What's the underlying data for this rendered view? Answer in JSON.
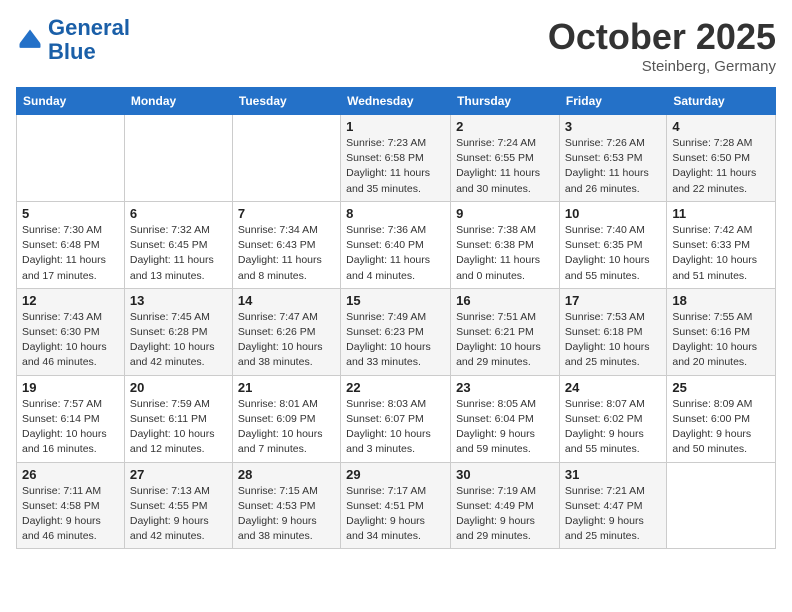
{
  "header": {
    "logo_line1": "General",
    "logo_line2": "Blue",
    "month": "October 2025",
    "location": "Steinberg, Germany"
  },
  "weekdays": [
    "Sunday",
    "Monday",
    "Tuesday",
    "Wednesday",
    "Thursday",
    "Friday",
    "Saturday"
  ],
  "weeks": [
    [
      {
        "day": "",
        "info": ""
      },
      {
        "day": "",
        "info": ""
      },
      {
        "day": "",
        "info": ""
      },
      {
        "day": "1",
        "info": "Sunrise: 7:23 AM\nSunset: 6:58 PM\nDaylight: 11 hours\nand 35 minutes."
      },
      {
        "day": "2",
        "info": "Sunrise: 7:24 AM\nSunset: 6:55 PM\nDaylight: 11 hours\nand 30 minutes."
      },
      {
        "day": "3",
        "info": "Sunrise: 7:26 AM\nSunset: 6:53 PM\nDaylight: 11 hours\nand 26 minutes."
      },
      {
        "day": "4",
        "info": "Sunrise: 7:28 AM\nSunset: 6:50 PM\nDaylight: 11 hours\nand 22 minutes."
      }
    ],
    [
      {
        "day": "5",
        "info": "Sunrise: 7:30 AM\nSunset: 6:48 PM\nDaylight: 11 hours\nand 17 minutes."
      },
      {
        "day": "6",
        "info": "Sunrise: 7:32 AM\nSunset: 6:45 PM\nDaylight: 11 hours\nand 13 minutes."
      },
      {
        "day": "7",
        "info": "Sunrise: 7:34 AM\nSunset: 6:43 PM\nDaylight: 11 hours\nand 8 minutes."
      },
      {
        "day": "8",
        "info": "Sunrise: 7:36 AM\nSunset: 6:40 PM\nDaylight: 11 hours\nand 4 minutes."
      },
      {
        "day": "9",
        "info": "Sunrise: 7:38 AM\nSunset: 6:38 PM\nDaylight: 11 hours\nand 0 minutes."
      },
      {
        "day": "10",
        "info": "Sunrise: 7:40 AM\nSunset: 6:35 PM\nDaylight: 10 hours\nand 55 minutes."
      },
      {
        "day": "11",
        "info": "Sunrise: 7:42 AM\nSunset: 6:33 PM\nDaylight: 10 hours\nand 51 minutes."
      }
    ],
    [
      {
        "day": "12",
        "info": "Sunrise: 7:43 AM\nSunset: 6:30 PM\nDaylight: 10 hours\nand 46 minutes."
      },
      {
        "day": "13",
        "info": "Sunrise: 7:45 AM\nSunset: 6:28 PM\nDaylight: 10 hours\nand 42 minutes."
      },
      {
        "day": "14",
        "info": "Sunrise: 7:47 AM\nSunset: 6:26 PM\nDaylight: 10 hours\nand 38 minutes."
      },
      {
        "day": "15",
        "info": "Sunrise: 7:49 AM\nSunset: 6:23 PM\nDaylight: 10 hours\nand 33 minutes."
      },
      {
        "day": "16",
        "info": "Sunrise: 7:51 AM\nSunset: 6:21 PM\nDaylight: 10 hours\nand 29 minutes."
      },
      {
        "day": "17",
        "info": "Sunrise: 7:53 AM\nSunset: 6:18 PM\nDaylight: 10 hours\nand 25 minutes."
      },
      {
        "day": "18",
        "info": "Sunrise: 7:55 AM\nSunset: 6:16 PM\nDaylight: 10 hours\nand 20 minutes."
      }
    ],
    [
      {
        "day": "19",
        "info": "Sunrise: 7:57 AM\nSunset: 6:14 PM\nDaylight: 10 hours\nand 16 minutes."
      },
      {
        "day": "20",
        "info": "Sunrise: 7:59 AM\nSunset: 6:11 PM\nDaylight: 10 hours\nand 12 minutes."
      },
      {
        "day": "21",
        "info": "Sunrise: 8:01 AM\nSunset: 6:09 PM\nDaylight: 10 hours\nand 7 minutes."
      },
      {
        "day": "22",
        "info": "Sunrise: 8:03 AM\nSunset: 6:07 PM\nDaylight: 10 hours\nand 3 minutes."
      },
      {
        "day": "23",
        "info": "Sunrise: 8:05 AM\nSunset: 6:04 PM\nDaylight: 9 hours\nand 59 minutes."
      },
      {
        "day": "24",
        "info": "Sunrise: 8:07 AM\nSunset: 6:02 PM\nDaylight: 9 hours\nand 55 minutes."
      },
      {
        "day": "25",
        "info": "Sunrise: 8:09 AM\nSunset: 6:00 PM\nDaylight: 9 hours\nand 50 minutes."
      }
    ],
    [
      {
        "day": "26",
        "info": "Sunrise: 7:11 AM\nSunset: 4:58 PM\nDaylight: 9 hours\nand 46 minutes."
      },
      {
        "day": "27",
        "info": "Sunrise: 7:13 AM\nSunset: 4:55 PM\nDaylight: 9 hours\nand 42 minutes."
      },
      {
        "day": "28",
        "info": "Sunrise: 7:15 AM\nSunset: 4:53 PM\nDaylight: 9 hours\nand 38 minutes."
      },
      {
        "day": "29",
        "info": "Sunrise: 7:17 AM\nSunset: 4:51 PM\nDaylight: 9 hours\nand 34 minutes."
      },
      {
        "day": "30",
        "info": "Sunrise: 7:19 AM\nSunset: 4:49 PM\nDaylight: 9 hours\nand 29 minutes."
      },
      {
        "day": "31",
        "info": "Sunrise: 7:21 AM\nSunset: 4:47 PM\nDaylight: 9 hours\nand 25 minutes."
      },
      {
        "day": "",
        "info": ""
      }
    ]
  ]
}
